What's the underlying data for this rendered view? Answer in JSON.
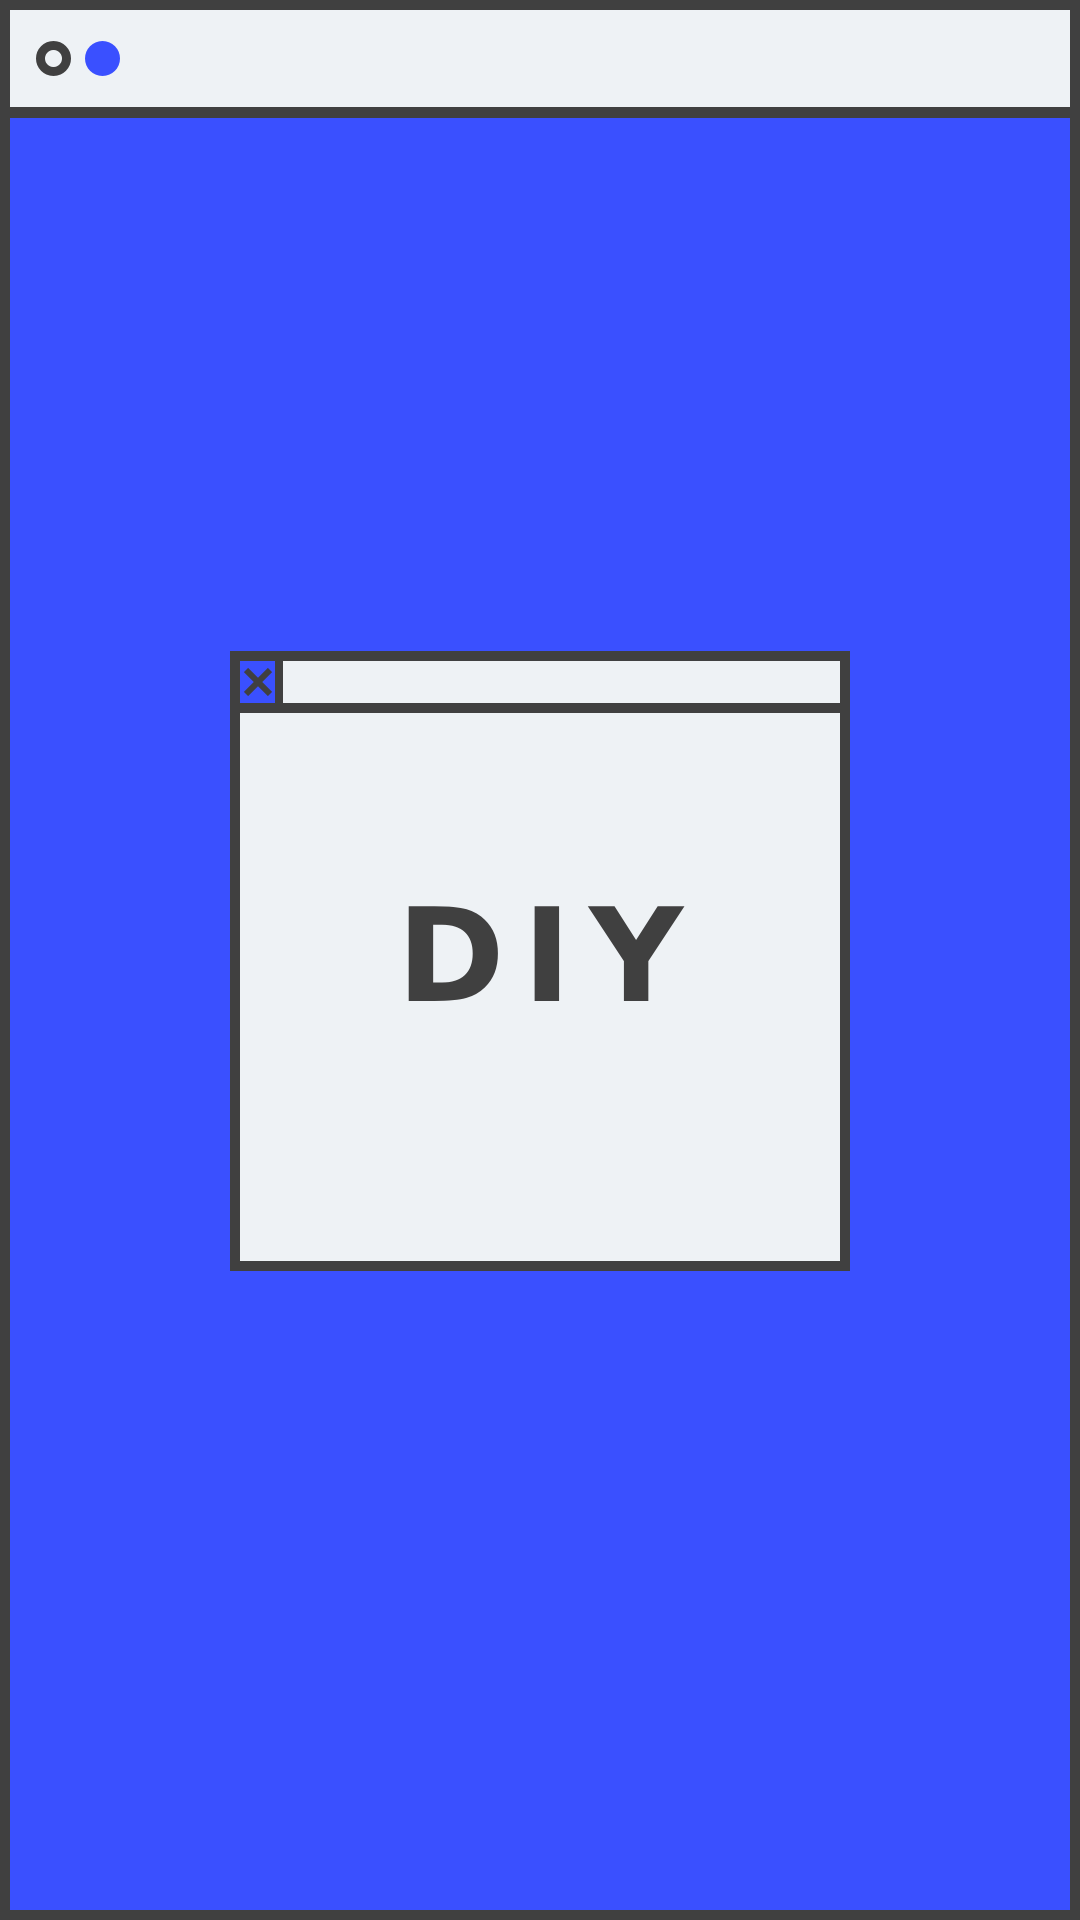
{
  "colors": {
    "frame": "#404040",
    "accent": "#3a50ff",
    "surface": "#eef2f5"
  },
  "toolbar": {
    "controls": [
      {
        "icon": "ring-icon"
      },
      {
        "icon": "dot-icon"
      }
    ]
  },
  "dialog": {
    "close_icon": "close-icon",
    "headline": "DIY"
  }
}
